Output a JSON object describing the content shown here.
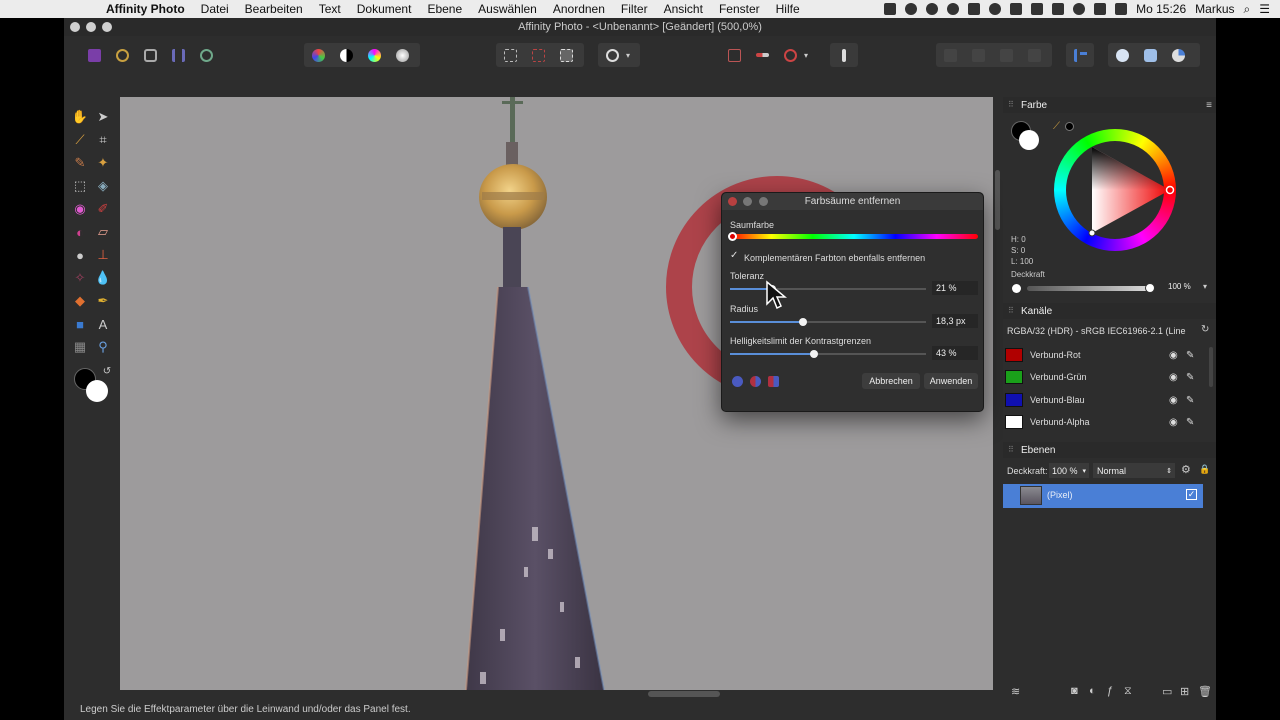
{
  "menubar": {
    "apple": "",
    "items": [
      "Affinity Photo",
      "Datei",
      "Bearbeiten",
      "Text",
      "Dokument",
      "Ebene",
      "Auswählen",
      "Anordnen",
      "Filter",
      "Ansicht",
      "Fenster",
      "Hilfe"
    ],
    "clock": "Mo 15:26",
    "user": "Markus"
  },
  "window": {
    "title": "Affinity Photo - <Unbenannt> [Geändert] (500,0%)"
  },
  "statusbar": {
    "hint": "Legen Sie die Effektparameter über die Leinwand und/oder das Panel fest."
  },
  "dialog": {
    "title": "Farbsäume entfernen",
    "fringe_color_label": "Saumfarbe",
    "complement_checkbox_label": "Komplementären Farbton ebenfalls entfernen",
    "complement_checked": true,
    "tolerance": {
      "label": "Toleranz",
      "value": "21 %",
      "fraction": 0.21
    },
    "radius": {
      "label": "Radius",
      "value": "18,3 px",
      "fraction": 0.37
    },
    "brightness_limit": {
      "label": "Helligkeitslimit der Kontrastgrenzen",
      "value": "43 %",
      "fraction": 0.43
    },
    "cancel_label": "Abbrechen",
    "apply_label": "Anwenden"
  },
  "color_panel": {
    "title": "Farbe",
    "h": "H: 0",
    "s": "S: 0",
    "l": "L: 100",
    "opacity_label": "Deckkraft",
    "opacity_value": "100 %"
  },
  "channels_panel": {
    "title": "Kanäle",
    "profile": "RGBA/32 (HDR) - sRGB IEC61966-2.1 (Line",
    "channels": [
      {
        "name": "Verbund-Rot",
        "color": "#b00000"
      },
      {
        "name": "Verbund-Grün",
        "color": "#1aa01a"
      },
      {
        "name": "Verbund-Blau",
        "color": "#1010b0"
      },
      {
        "name": "Verbund-Alpha",
        "color": "#ffffff"
      }
    ]
  },
  "layers_panel": {
    "title": "Ebenen",
    "opacity_label": "Deckkraft:",
    "opacity_value": "100 %",
    "blend_mode": "Normal",
    "layer_name": "(Pixel)"
  },
  "colors": {
    "accent": "#4a7fd6",
    "canvas_bg": "#9c9a9c"
  }
}
